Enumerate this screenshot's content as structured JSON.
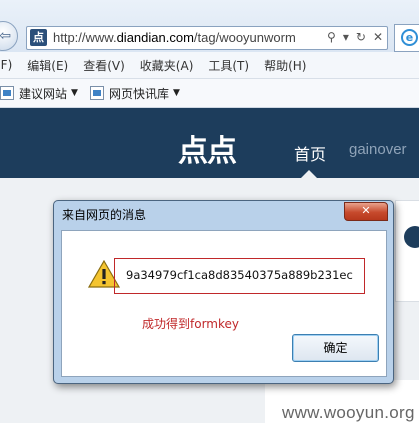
{
  "browser": {
    "favicon_text": "点",
    "url_prefix": "http://www.",
    "url_domain": "diandian.com",
    "url_path": "/tag/wooyunworm",
    "icons": [
      "search-icon",
      "dropdown-icon",
      "refresh-icon",
      "stop-icon"
    ],
    "icon_glyphs": [
      "⚲",
      "▾",
      "↻",
      "✕"
    ],
    "menu": [
      "(F)",
      "编辑(E)",
      "查看(V)",
      "收藏夹(A)",
      "工具(T)",
      "帮助(H)"
    ],
    "favorites": [
      {
        "label": "建议网站",
        "caret": "▼"
      },
      {
        "label": "网页快讯库",
        "caret": "▼"
      }
    ]
  },
  "site": {
    "logo": "点点",
    "nav_home": "首页",
    "nav_user": "gainover",
    "watermark": "www.wooyun.org"
  },
  "dialog": {
    "title": "来自网页的消息",
    "close_glyph": "✕",
    "message": "9a34979cf1ca8d83540375a889b231ec",
    "note": "成功得到formkey",
    "ok_label": "确定"
  },
  "colors": {
    "header_bg": "#1d3d5c",
    "note_red": "#c0282a",
    "dialog_frame": "#b9d1ea"
  }
}
